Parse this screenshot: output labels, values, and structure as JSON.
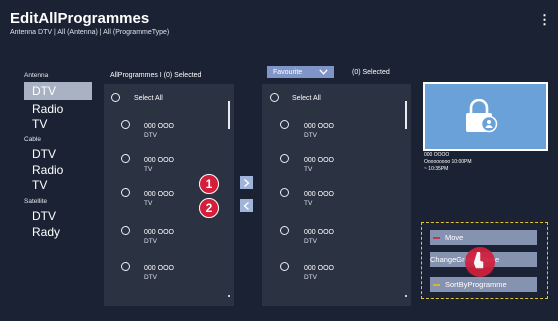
{
  "header": {
    "title": "EditAllProgrammes",
    "subtitle": "Antenna DTV | All (Antenna) | All (ProgrammeType)",
    "menu_icon": "⋮"
  },
  "sidebar": {
    "groups": [
      {
        "heading": "Antenna",
        "items": [
          "DTV",
          "Radio",
          "TV"
        ]
      },
      {
        "heading": "Cable",
        "items": [
          "DTV",
          "Radio",
          "TV"
        ]
      },
      {
        "heading": "Satellite",
        "items": [
          "DTV",
          "Rady"
        ]
      }
    ]
  },
  "left_list": {
    "header": "AllProgrammes I (0) Selected",
    "select_all": "Select All",
    "items": [
      {
        "title": "000 OOO",
        "sub": "DTV"
      },
      {
        "title": "000 OOO",
        "sub": "TV"
      },
      {
        "title": "000 OOO",
        "sub": "TV"
      },
      {
        "title": "000 OOO",
        "sub": "DTV"
      },
      {
        "title": "000 OOO",
        "sub": "DTV"
      }
    ]
  },
  "right_list": {
    "dropdown": "Favourite",
    "header": "(0) Selected",
    "select_all": "Select All",
    "items": [
      {
        "title": "000 OOO",
        "sub": "DTV"
      },
      {
        "title": "000 OOO",
        "sub": "TV"
      },
      {
        "title": "000 OOO",
        "sub": "TV"
      },
      {
        "title": "000 OOO",
        "sub": "DTV"
      },
      {
        "title": "000 OOO",
        "sub": "DTV"
      }
    ]
  },
  "markers": [
    "1",
    "2"
  ],
  "preview": {
    "line1": "000 OOOO",
    "line2": "Ooooooooo 10:00PM",
    "line3": "~ 10:35PM"
  },
  "context_menu": {
    "items": [
      {
        "label": "Move",
        "swatch": "#c0364a"
      },
      {
        "label": "ChangeGroup Name",
        "swatch": ""
      },
      {
        "label": "SortByProgramme",
        "swatch": "#d7b62a"
      }
    ]
  },
  "colors": {
    "background": "#1a2233",
    "panel": "#2b3242",
    "accent_blue": "#9fb4d8",
    "marker_red": "#d31f3c",
    "focus_yellow": "#e3c436"
  }
}
